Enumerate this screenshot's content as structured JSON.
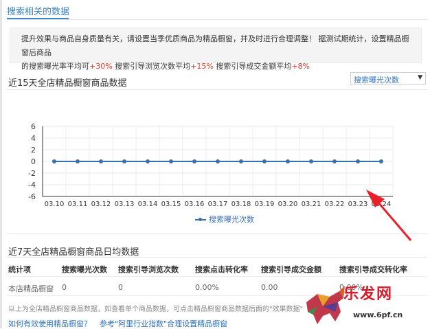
{
  "top_tab": {
    "label": "搜索相关的数据"
  },
  "notice": {
    "line1": "提升效果与商品自身质量有关，请设置当季优质商品为精品橱窗，并及时进行合理调整！ 据测试期统计，设置精品橱窗后商品",
    "line2_a": "的搜索曝光率平均可",
    "line2_pct1": "+30%",
    "line2_b": "  搜索引导浏览次数平均",
    "line2_pct2": "+15%",
    "line2_c": "  搜索引导成交金额平均",
    "line2_pct3": "+8%"
  },
  "section1": {
    "title": "近15天全店精品橱窗商品数据",
    "metric_select": {
      "value": "搜索曝光次数"
    }
  },
  "chart_data": {
    "type": "line",
    "categories": [
      "03.10",
      "03.11",
      "03.12",
      "03.13",
      "03.14",
      "03.15",
      "03.16",
      "03.17",
      "03.18",
      "03.19",
      "03.20",
      "03.21",
      "03.22",
      "03.23",
      "03.24"
    ],
    "series": [
      {
        "name": "搜索曝光次数",
        "values": [
          0,
          0,
          0,
          0,
          0,
          0,
          0,
          0,
          0,
          0,
          0,
          0,
          0,
          0,
          0
        ],
        "color": "#3a6fb0"
      }
    ],
    "yticks": [
      "6",
      "4",
      "2",
      "0",
      "-2",
      "-4",
      "-6"
    ],
    "ylim": [
      -6,
      6
    ],
    "grid": true,
    "legend": "bottom-center"
  },
  "section2": {
    "title": "近7天全店精品橱窗商品日均数据",
    "headers": [
      "统计项",
      "搜索曝光次数",
      "搜索引导浏览次数",
      "搜索点击转化率",
      "搜索引导成交金额",
      "搜索引导成交转化率"
    ],
    "row": [
      "本店精品橱窗",
      "0",
      "0",
      "0.00%",
      "0.00",
      "0.00%"
    ]
  },
  "footnote": "以上为全店精品橱窗商品数据，如查看单个商品数据，可点击精品橱窗商品数据后面的\"效果数据\"",
  "links": {
    "how_to": "如何有效使用精品橱窗？",
    "reference": "参考\"阿里行业指数\"合理设置精品橱窗"
  },
  "watermark": {
    "brand": "乐发网",
    "url": "www.6pf.cn"
  },
  "colors": {
    "accent": "#3a86c8",
    "series": "#3a6fb0",
    "positive": "#e3362a",
    "annotation_arrow": "#e8202a"
  }
}
